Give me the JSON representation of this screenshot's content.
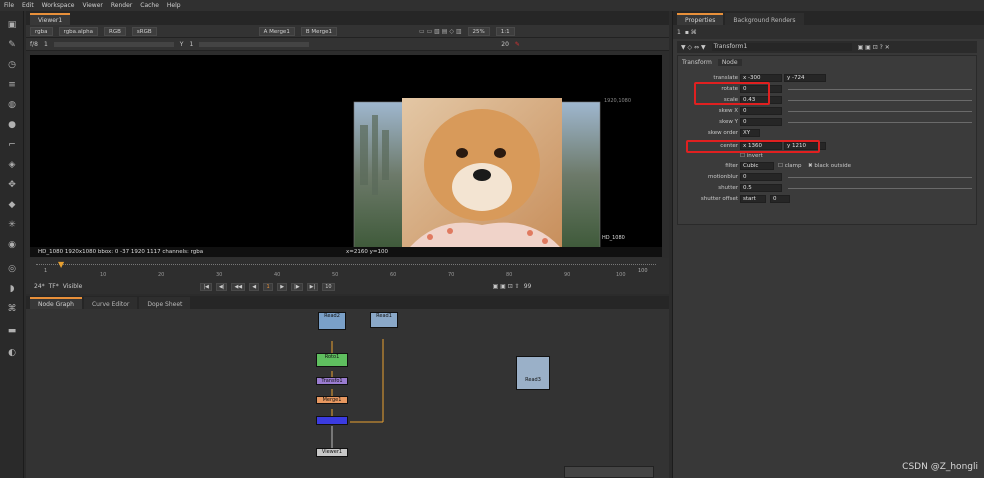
{
  "menubar": [
    "File",
    "Edit",
    "Workspace",
    "Viewer",
    "Render",
    "Cache",
    "Help"
  ],
  "viewer": {
    "tab": "Viewer1",
    "channels": "rgba",
    "alpha": "rgba.alpha",
    "colorspace": "RGB",
    "lut": "sRGB",
    "input_a": "A  Merge1",
    "input_b": "B  Merge1",
    "zoom": "25%",
    "ratio": "1:1",
    "fstop": "f/8",
    "frame": "1",
    "y_label": "Y",
    "y_value": "1",
    "right_frame": "20",
    "format_label": "1920,1080",
    "corner_label": "HD_1080",
    "status": "HD_1080 1920x1080  bbox: 0 -37 1920 1117 channels: rgba",
    "coords": "x=2160 y=100"
  },
  "timeline": {
    "start": "1",
    "end": "100",
    "ticks": [
      "10",
      "20",
      "30",
      "40",
      "50",
      "60",
      "70",
      "80",
      "90",
      "100"
    ],
    "fps": "24*",
    "tf": "TF*",
    "visible": "Visible",
    "frame_current": "1",
    "step": "10",
    "end_frame": "99"
  },
  "nodegraph": {
    "tabs": [
      "Node Graph",
      "Curve Editor",
      "Dope Sheet"
    ],
    "nodes": {
      "read2": "Read2",
      "read1": "Read1",
      "roto1": "Roto1",
      "trans1": "Transfo1",
      "merge1": "Merge1",
      "viewer1": "Viewer1",
      "read3": "Read3"
    }
  },
  "properties": {
    "tabs": [
      "Properties",
      "Background Renders"
    ],
    "node_name": "Transform1",
    "subtabs": [
      "Transform",
      "Node"
    ],
    "translate_label": "translate",
    "translate_x": "-300",
    "translate_y": "-724",
    "rotate_label": "rotate",
    "rotate": "0",
    "scale_label": "scale",
    "scale": "0.43",
    "skewx_label": "skew X",
    "skewx": "0",
    "skewy_label": "skew Y",
    "skewy": "0",
    "skeworder_label": "skew order",
    "skeworder": "XY",
    "center_label": "center",
    "center_x": "1360",
    "center_y": "1210",
    "invert": "invert",
    "filter_label": "filter",
    "filter": "Cubic",
    "clamp": "clamp",
    "black_outside": "black outside",
    "motionblur_label": "motionblur",
    "motionblur": "0",
    "shutter_label": "shutter",
    "shutter": "0.5",
    "shutteroffset_label": "shutter offset",
    "shutteroffset": "start",
    "shutteroffset_val": "0"
  },
  "watermark": "CSDN @Z_hongli",
  "colors": {
    "accent": "#e8903a",
    "highlight": "#e02020",
    "roto": "#5fbf5f",
    "transform": "#9a7cd0",
    "merge": "#3b3be0",
    "viewer": "#c8c8c8"
  }
}
